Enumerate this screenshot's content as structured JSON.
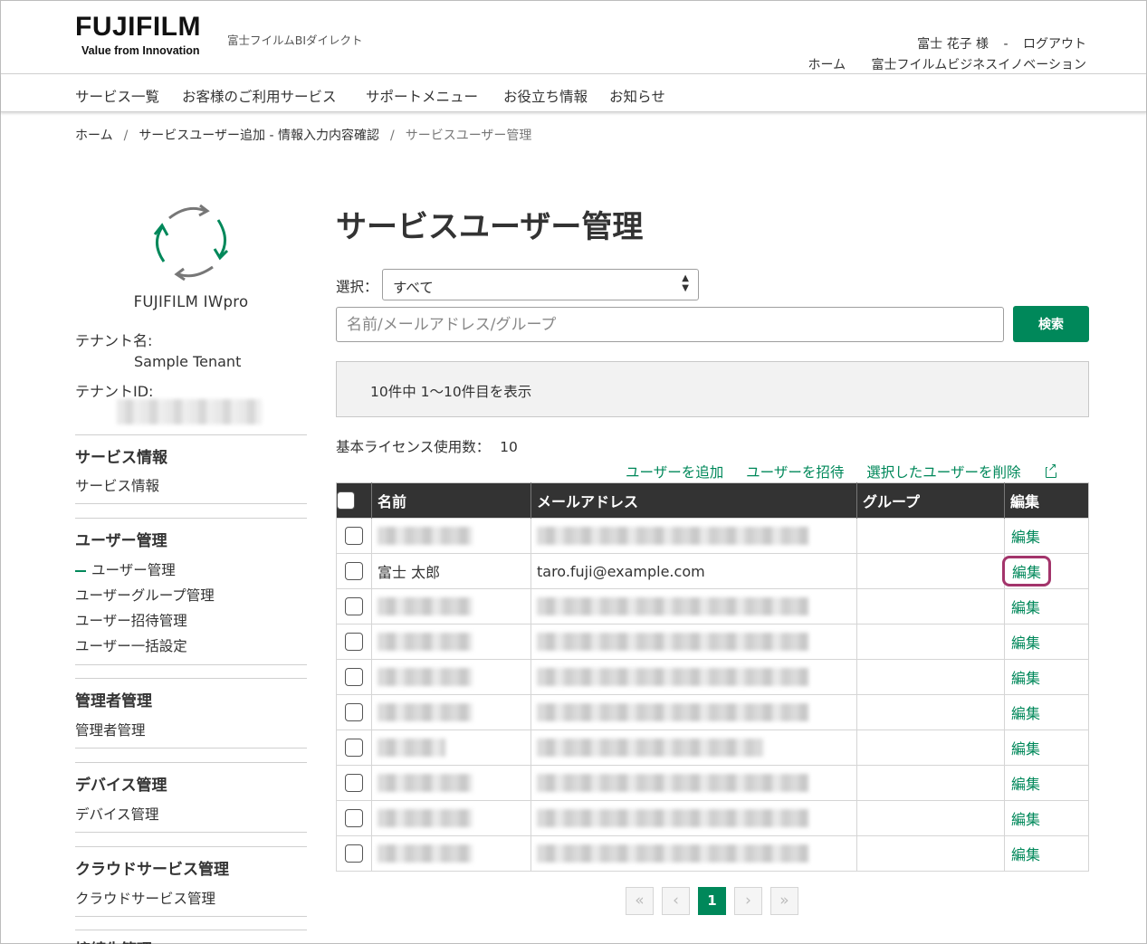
{
  "header": {
    "logo_text": "FUJIFILM",
    "logo_tagline": "Value from Innovation",
    "site_name": "富士フイルムBIダイレクト",
    "user_name": "富士 花子 様",
    "separator": "-",
    "logout": "ログアウト",
    "home_link": "ホーム",
    "company_link": "富士フイルムビジネスイノベーション"
  },
  "nav": {
    "items": [
      "サービス一覧",
      "お客様のご利用サービス",
      "サポートメニュー",
      "お役立ち情報",
      "お知らせ"
    ]
  },
  "breadcrumb": {
    "items": [
      "ホーム",
      "サービスユーザー追加 - 情報入力内容確認",
      "サービスユーザー管理"
    ],
    "separator": "/"
  },
  "sidebar": {
    "app_name": "FUJIFILM IWpro",
    "tenant_name_label": "テナント名:",
    "tenant_name": "Sample Tenant",
    "tenant_id_label": "テナントID:",
    "sections": [
      {
        "heading": "サービス情報",
        "links": [
          "サービス情報"
        ]
      },
      {
        "heading": "ユーザー管理",
        "links": [
          "ユーザー管理",
          "ユーザーグループ管理",
          "ユーザー招待管理",
          "ユーザー一括設定"
        ]
      },
      {
        "heading": "管理者管理",
        "links": [
          "管理者管理"
        ]
      },
      {
        "heading": "デバイス管理",
        "links": [
          "デバイス管理"
        ]
      },
      {
        "heading": "クラウドサービス管理",
        "links": [
          "クラウドサービス管理"
        ]
      },
      {
        "heading": "接続先管理",
        "links": []
      }
    ]
  },
  "main": {
    "title": "サービスユーザー管理",
    "select_label": "選択：",
    "select_value": "すべて",
    "search_placeholder": "名前/メールアドレス/グループ",
    "search_button": "検索",
    "result_text": "10件中 1〜10件目を表示",
    "license_label": "基本ライセンス使用数：",
    "license_count": "10",
    "actions": [
      "ユーザーを追加",
      "ユーザーを招待",
      "選択したユーザーを削除"
    ],
    "table": {
      "headers": [
        "名前",
        "メールアドレス",
        "グループ",
        "編集"
      ],
      "edit_label": "編集",
      "visible_row": {
        "name": "富士 太郎",
        "email": "taro.fuji@example.com"
      }
    },
    "pagination": {
      "current": "1"
    }
  },
  "colors": {
    "accent": "#00885a",
    "highlight": "#a3346b",
    "table_header": "#333333"
  }
}
